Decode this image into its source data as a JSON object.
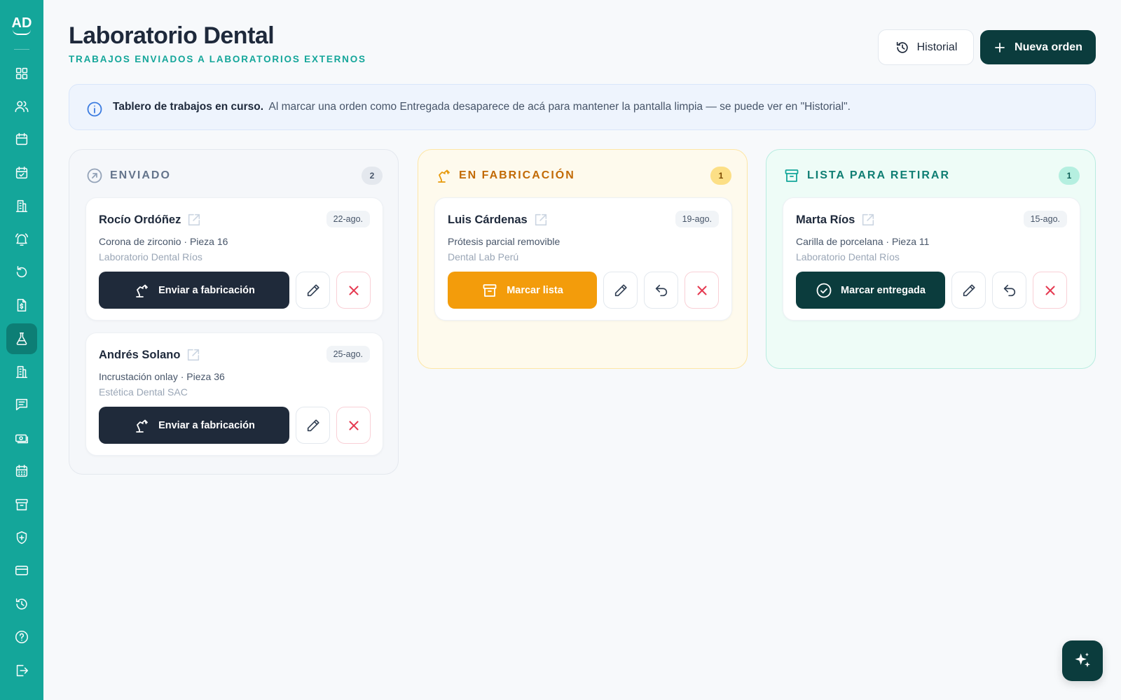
{
  "sidebar": {
    "logo": "AD",
    "items": [
      {
        "name": "dashboard",
        "icon": "grid-icon"
      },
      {
        "name": "patients",
        "icon": "users-icon"
      },
      {
        "name": "calendar",
        "icon": "calendar-icon"
      },
      {
        "name": "tasks",
        "icon": "calendar-check-icon"
      },
      {
        "name": "rooms",
        "icon": "building-icon"
      },
      {
        "name": "alerts",
        "icon": "bell-icon"
      },
      {
        "name": "refresh",
        "icon": "refresh-icon"
      },
      {
        "name": "billing",
        "icon": "document-dollar-icon"
      },
      {
        "name": "laboratory",
        "icon": "flask-icon",
        "active": true
      },
      {
        "name": "offices",
        "icon": "building-icon"
      },
      {
        "name": "messages",
        "icon": "message-icon"
      },
      {
        "name": "payments",
        "icon": "cash-icon"
      },
      {
        "name": "schedule",
        "icon": "calendar-grid-icon"
      },
      {
        "name": "archive",
        "icon": "archive-icon"
      },
      {
        "name": "insurance",
        "icon": "shield-icon"
      },
      {
        "name": "cards",
        "icon": "credit-card-icon"
      },
      {
        "name": "history",
        "icon": "history-icon"
      }
    ],
    "bottom": [
      {
        "name": "help",
        "icon": "help-icon"
      },
      {
        "name": "logout",
        "icon": "logout-icon"
      }
    ]
  },
  "header": {
    "title": "Laboratorio Dental",
    "subtitle": "TRABAJOS ENVIADOS A LABORATORIOS EXTERNOS",
    "history_label": "Historial",
    "new_order_label": "Nueva orden"
  },
  "info": {
    "bold": "Tablero de trabajos en curso.",
    "text": "Al marcar una orden como Entregada desaparece de acá para mantener la pantalla limpia — se puede ver en \"Historial\"."
  },
  "columns": [
    {
      "title": "ENVIADO",
      "count": "2",
      "cards": [
        {
          "name": "Rocío Ordóñez",
          "date": "22-ago.",
          "desc": "Corona de zirconio · Pieza 16",
          "lab": "Laboratorio Dental Ríos",
          "action": "Enviar a fabricación"
        },
        {
          "name": "Andrés Solano",
          "date": "25-ago.",
          "desc": "Incrustación onlay · Pieza 36",
          "lab": "Estética Dental SAC",
          "action": "Enviar a fabricación"
        }
      ]
    },
    {
      "title": "EN FABRICACIÓN",
      "count": "1",
      "cards": [
        {
          "name": "Luis Cárdenas",
          "date": "19-ago.",
          "desc": "Prótesis parcial removible",
          "lab": "Dental Lab Perú",
          "action": "Marcar lista"
        }
      ]
    },
    {
      "title": "LISTA PARA RETIRAR",
      "count": "1",
      "cards": [
        {
          "name": "Marta Ríos",
          "date": "15-ago.",
          "desc": "Carilla de porcelana · Pieza 11",
          "lab": "Laboratorio Dental Ríos",
          "action": "Marcar entregada"
        }
      ]
    }
  ],
  "colors": {
    "sidebar": "#14a69a",
    "primary_dark": "#0b3c3d",
    "amber": "#f39c0b",
    "danger": "#e53950"
  }
}
